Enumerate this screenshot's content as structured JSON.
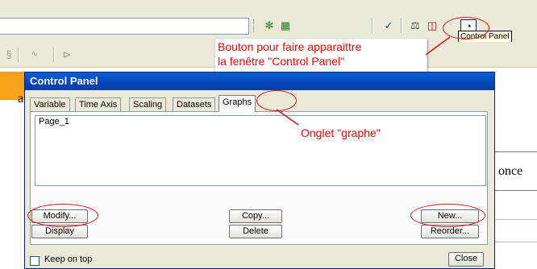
{
  "toolbar": {
    "icons": [
      "run-icon",
      "chart-icon",
      "check-run-icon",
      "scale-icon",
      "graph-icon",
      "gauge-icon"
    ],
    "row2_icons": [
      "tool-icon",
      "graph-small-icon",
      "arrow-icon"
    ]
  },
  "tooltip": "Control Panel",
  "annotations": {
    "button_note_line1": "Bouton pour faire apparaittre",
    "button_note_line2": "la fenêtre \"Control Panel\"",
    "tab_note": "Onglet \"graphe\""
  },
  "document": {
    "partial_letter": "a",
    "partial_word": "once"
  },
  "control_panel": {
    "title": "Control Panel",
    "tabs": [
      {
        "label": "Variable"
      },
      {
        "label": "Time Axis"
      },
      {
        "label": "Scaling"
      },
      {
        "label": "Datasets"
      },
      {
        "label": "Graphs"
      }
    ],
    "active_tab": "Graphs",
    "list_items": [
      "Page_1"
    ],
    "buttons": {
      "modify": "Modify...",
      "display": "Display",
      "copy": "Copy...",
      "delete": "Delete",
      "new": "New...",
      "reorder": "Reorder..."
    },
    "keep_on_top_label": "Keep on top",
    "keep_on_top_checked": false,
    "close_label": "Close"
  },
  "colors": {
    "accent_red": "#ff0000",
    "title_blue": "#0545b7",
    "doc_orange": "#f6a21b"
  }
}
